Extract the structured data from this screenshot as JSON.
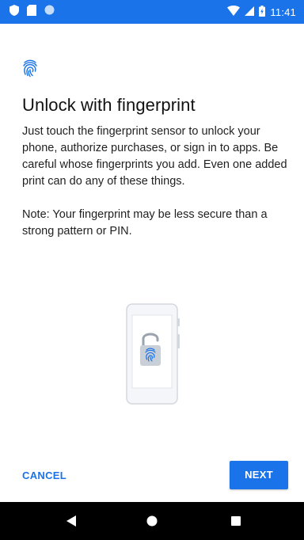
{
  "status_bar": {
    "time": "11:41",
    "background_color": "#1a73e8",
    "icons_left": [
      "shield-icon",
      "sd-card-icon",
      "circle-icon"
    ],
    "icons_right": [
      "wifi-icon",
      "signal-icon",
      "battery-icon"
    ]
  },
  "header_icon": "fingerprint-icon",
  "title": "Unlock with fingerprint",
  "body": "Just touch the fingerprint sensor to unlock your phone, authorize purchases, or sign in to apps. Be careful whose fingerprints you add. Even one added print can do any of these things.",
  "note": "Note: Your fingerprint may be less secure than a strong pattern or PIN.",
  "illustration_icon": "phone-unlock-fingerprint-illustration",
  "actions": {
    "cancel_label": "CANCEL",
    "next_label": "NEXT"
  },
  "accent_color": "#1a73e8",
  "nav_bar": {
    "icons": [
      "back-icon",
      "home-icon",
      "recents-icon"
    ]
  }
}
